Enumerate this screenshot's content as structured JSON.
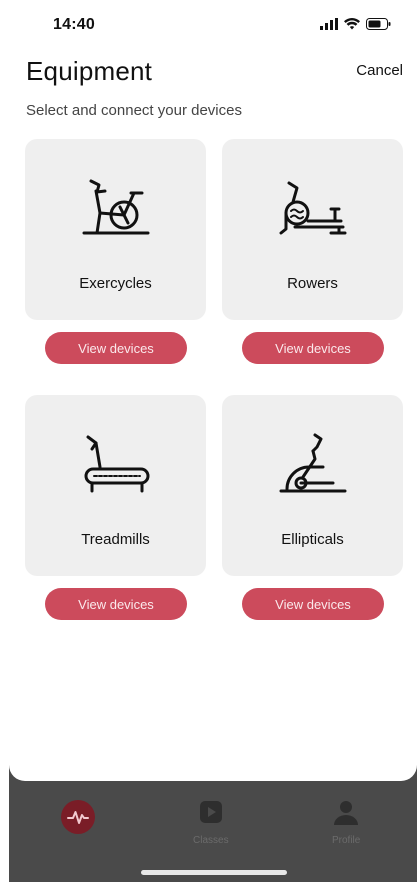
{
  "status": {
    "time": "14:40"
  },
  "header": {
    "title": "Equipment",
    "cancel_label": "Cancel",
    "subtitle": "Select and connect your devices"
  },
  "equipment": [
    {
      "label": "Exercycles",
      "icon": "exercycle-icon",
      "button_label": "View devices"
    },
    {
      "label": "Rowers",
      "icon": "rower-icon",
      "button_label": "View devices"
    },
    {
      "label": "Treadmills",
      "icon": "treadmill-icon",
      "button_label": "View devices"
    },
    {
      "label": "Ellipticals",
      "icon": "elliptical-icon",
      "button_label": "View devices"
    }
  ],
  "tabbar": {
    "tabs": [
      {
        "label": "",
        "icon": "activity-icon"
      },
      {
        "label": "Classes",
        "icon": "play-icon"
      },
      {
        "label": "Profile",
        "icon": "person-icon"
      }
    ]
  },
  "colors": {
    "accent": "#cc4b5c",
    "card": "#efefef",
    "tabbar": "#4a4a4a"
  }
}
